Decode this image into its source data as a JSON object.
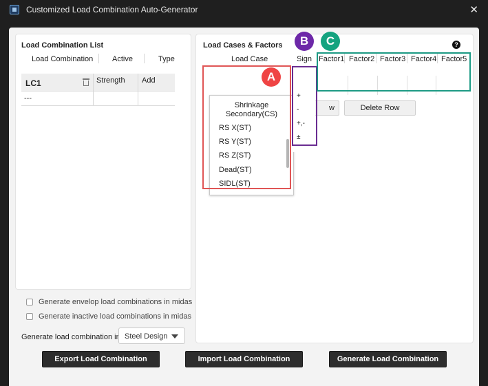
{
  "window": {
    "title": "Customized Load Combination Auto-Generator",
    "close_glyph": "✕"
  },
  "left_panel": {
    "title": "Load Combination List",
    "columns": [
      "Load Combination",
      "Active",
      "Type"
    ],
    "rows": [
      {
        "name": "LC1",
        "active": "Strength",
        "type": "Add"
      },
      {
        "name": "---",
        "active": "",
        "type": ""
      }
    ],
    "options": [
      {
        "label": "Generate envelop load combinations in midas",
        "checked": false
      },
      {
        "label": "Generate inactive load combinations in midas",
        "checked": false
      }
    ],
    "generate_in_label": "Generate load combination in:",
    "generate_in_value": "Steel Design"
  },
  "right_panel": {
    "title": "Load Cases & Factors",
    "load_case_header": "Load Case",
    "sign_header": "Sign",
    "factor_headers": [
      "Factor1",
      "Factor2",
      "Factor3",
      "Factor4",
      "Factor5"
    ],
    "add_row_partial": "w",
    "delete_row_label": "Delete Row",
    "help_icon": "?",
    "load_case_options": [
      "Shrinkage Secondary(CS)",
      "RS X(ST)",
      "RS Y(ST)",
      "RS Z(ST)",
      "Dead(ST)",
      "SIDL(ST)"
    ],
    "sign_options": [
      "+",
      "-",
      "+,-",
      "±"
    ]
  },
  "bottom_buttons": {
    "export": "Export Load Combination",
    "import": "Import Load Combination",
    "generate": "Generate Load Combination"
  },
  "annotations": [
    {
      "label": "A",
      "color": "#ef4444"
    },
    {
      "label": "B",
      "color": "#6d28a8"
    },
    {
      "label": "C",
      "color": "#14a37f"
    }
  ],
  "colors": {
    "red_box": "#e05555",
    "purple_box": "#6a2c91",
    "green_box": "#1c9a84"
  }
}
